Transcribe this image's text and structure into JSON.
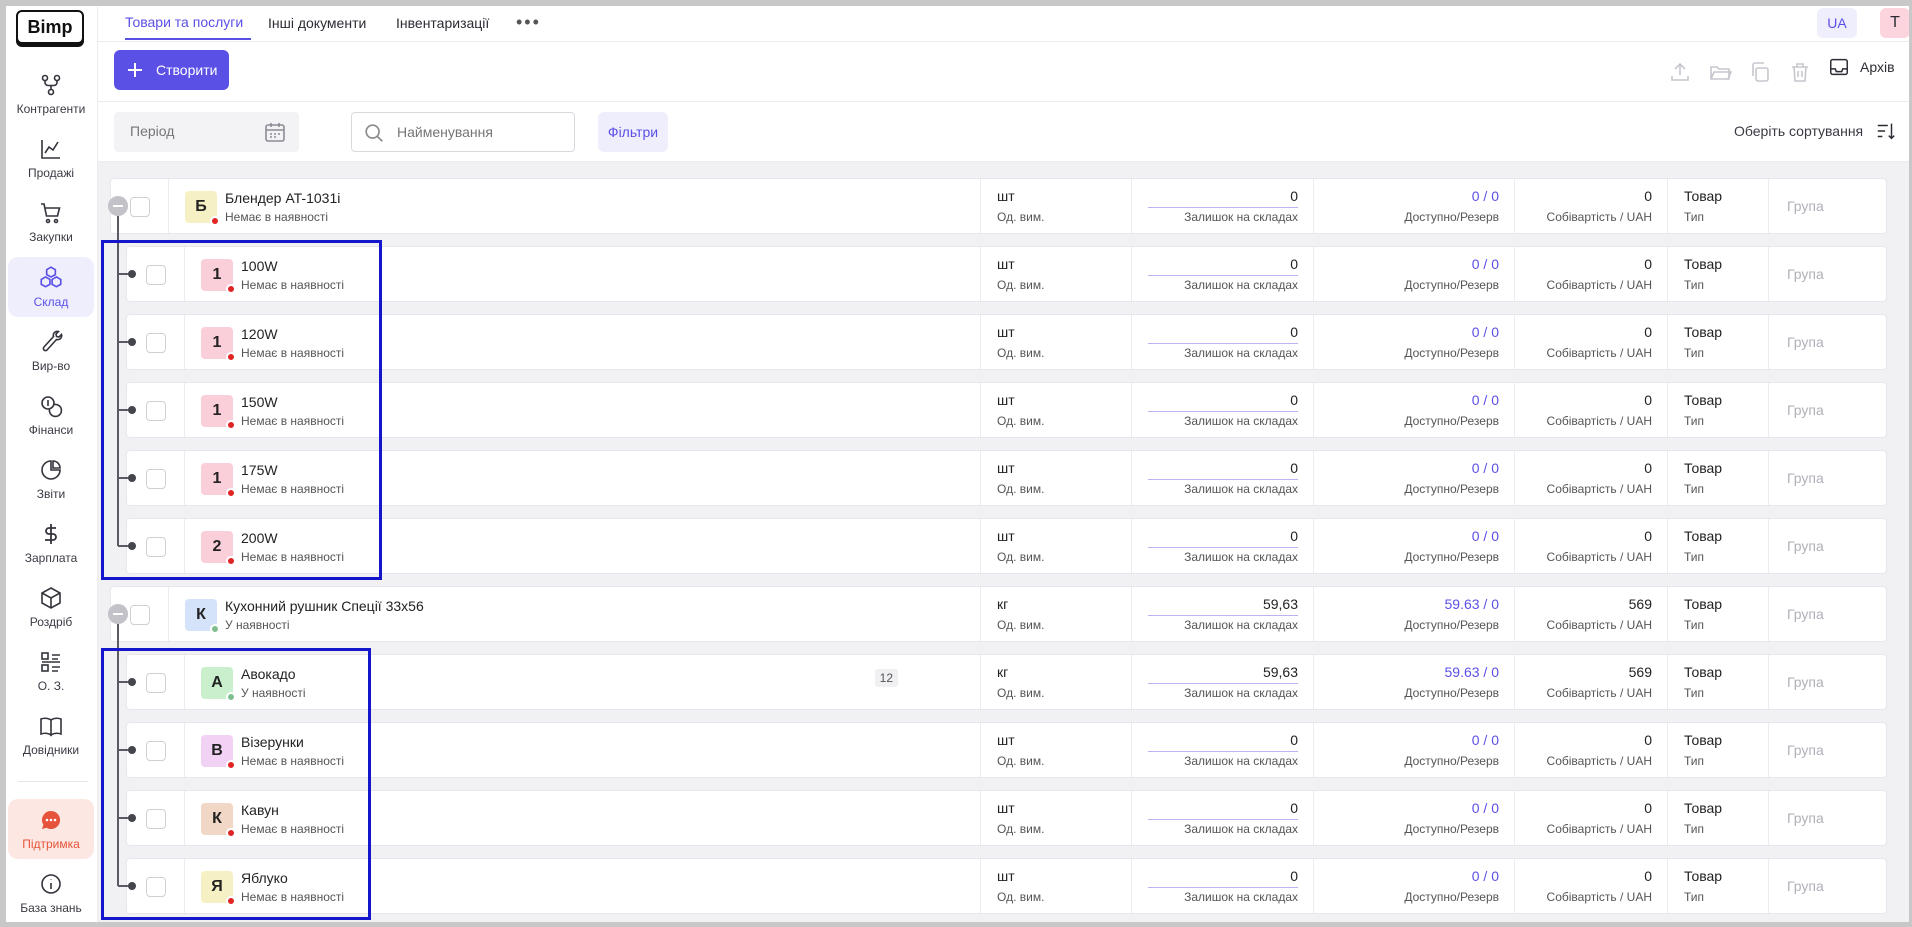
{
  "app": {
    "logo": "Bimp"
  },
  "sidebar": {
    "items": [
      {
        "label": "Контрагенти",
        "icon": "network-icon"
      },
      {
        "label": "Продажі",
        "icon": "chart-line-icon"
      },
      {
        "label": "Закупки",
        "icon": "cart-icon"
      },
      {
        "label": "Склад",
        "icon": "boxes-icon",
        "active": true
      },
      {
        "label": "Вир-во",
        "icon": "wrench-icon"
      },
      {
        "label": "Фінанси",
        "icon": "coins-icon"
      },
      {
        "label": "Звіти",
        "icon": "pie-chart-icon"
      },
      {
        "label": "Зарплата",
        "icon": "dollar-icon"
      },
      {
        "label": "Роздріб",
        "icon": "box-icon"
      },
      {
        "label": "О. З.",
        "icon": "list-icon"
      },
      {
        "label": "Довідники",
        "icon": "book-icon"
      },
      {
        "label": "Підтримка",
        "icon": "chat-icon"
      },
      {
        "label": "База знань",
        "icon": "info-icon"
      }
    ]
  },
  "tabs": [
    {
      "label": "Товари та послуги",
      "active": true
    },
    {
      "label": "Інші документи"
    },
    {
      "label": "Інвентаризації"
    }
  ],
  "header": {
    "lang": "UA",
    "user_initial": "T"
  },
  "toolbar": {
    "create_label": "Створити",
    "archive_label": "Архів"
  },
  "filters": {
    "period_placeholder": "Період",
    "search_placeholder": "Найменування",
    "filters_label": "Фільтри",
    "sort_label": "Оберіть сортування"
  },
  "colors": {
    "accent": "#5b50e6",
    "out_of_stock": "#e02424",
    "in_stock": "#7fbf8f",
    "highlight": "#1515cc"
  },
  "labels": {
    "unit": "Од. вим.",
    "stock": "Залишок на складах",
    "available": "Доступно/Резерв",
    "cost": "Собівартість / UAH",
    "type": "Тип",
    "group": "Група"
  },
  "products": [
    {
      "level": 0,
      "initial": "Б",
      "name": "Блендер AT-1031i",
      "status": "Немає в наявності",
      "in_stock": false,
      "unit": "шт",
      "stock": "0",
      "avail": "0 / 0",
      "cost": "0",
      "type": "Товар",
      "avatar": "#f6f1c4"
    },
    {
      "level": 1,
      "initial": "1",
      "name": "100W",
      "status": "Немає в наявності",
      "in_stock": false,
      "unit": "шт",
      "stock": "0",
      "avail": "0 / 0",
      "cost": "0",
      "type": "Товар",
      "avatar": "#fbcfd9"
    },
    {
      "level": 1,
      "initial": "1",
      "name": "120W",
      "status": "Немає в наявності",
      "in_stock": false,
      "unit": "шт",
      "stock": "0",
      "avail": "0 / 0",
      "cost": "0",
      "type": "Товар",
      "avatar": "#fbcfd9"
    },
    {
      "level": 1,
      "initial": "1",
      "name": "150W",
      "status": "Немає в наявності",
      "in_stock": false,
      "unit": "шт",
      "stock": "0",
      "avail": "0 / 0",
      "cost": "0",
      "type": "Товар",
      "avatar": "#fbcfd9"
    },
    {
      "level": 1,
      "initial": "1",
      "name": "175W",
      "status": "Немає в наявності",
      "in_stock": false,
      "unit": "шт",
      "stock": "0",
      "avail": "0 / 0",
      "cost": "0",
      "type": "Товар",
      "avatar": "#fbcfd9"
    },
    {
      "level": 1,
      "initial": "2",
      "name": "200W",
      "status": "Немає в наявності",
      "in_stock": false,
      "unit": "шт",
      "stock": "0",
      "avail": "0 / 0",
      "cost": "0",
      "type": "Товар",
      "avatar": "#fbcfd9"
    },
    {
      "level": 0,
      "initial": "К",
      "name": "Кухонний рушник Спеції 33х56",
      "status": "У наявності",
      "in_stock": true,
      "unit": "кг",
      "stock": "59,63",
      "avail": "59.63 / 0",
      "cost": "569",
      "type": "Товар",
      "avatar": "#d5e3fa"
    },
    {
      "level": 1,
      "initial": "А",
      "name": "Авокадо",
      "status": "У наявності",
      "in_stock": true,
      "unit": "кг",
      "stock": "59,63",
      "avail": "59.63 / 0",
      "cost": "569",
      "type": "Товар",
      "avatar": "#c9efcc",
      "badge": "12"
    },
    {
      "level": 1,
      "initial": "В",
      "name": "Візерунки",
      "status": "Немає в наявності",
      "in_stock": false,
      "unit": "шт",
      "stock": "0",
      "avail": "0 / 0",
      "cost": "0",
      "type": "Товар",
      "avatar": "#f1d2f4"
    },
    {
      "level": 1,
      "initial": "К",
      "name": "Кавун",
      "status": "Немає в наявності",
      "in_stock": false,
      "unit": "шт",
      "stock": "0",
      "avail": "0 / 0",
      "cost": "0",
      "type": "Товар",
      "avatar": "#f1d7c6"
    },
    {
      "level": 1,
      "initial": "Я",
      "name": "Яблуко",
      "status": "Немає в наявності",
      "in_stock": false,
      "unit": "шт",
      "stock": "0",
      "avail": "0 / 0",
      "cost": "0",
      "type": "Товар",
      "avatar": "#f6f1c4"
    }
  ]
}
